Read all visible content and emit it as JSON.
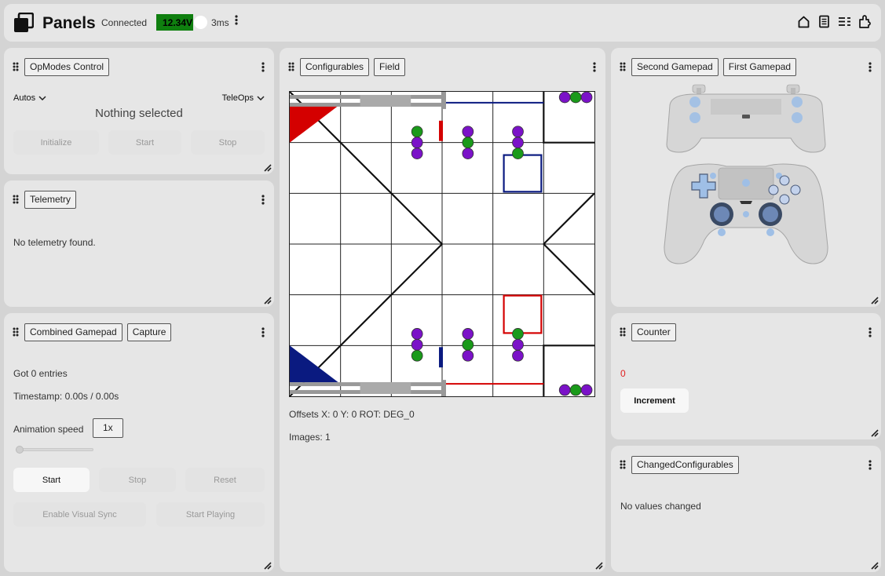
{
  "header": {
    "title": "Panels",
    "connection_status": "Connected",
    "battery_voltage": "12.34V",
    "battery_level": 0.75,
    "battery_color": "#0f7f0f",
    "latency": "3ms",
    "icons": [
      "panels-logo-icon",
      "more-vertical-icon",
      "home-icon",
      "document-icon",
      "list-settings-icon",
      "plugin-icon"
    ]
  },
  "opmodes": {
    "tab": "OpModes Control",
    "autos_label": "Autos",
    "teleops_label": "TeleOps",
    "status": "Nothing selected",
    "buttons": {
      "initialize": "Initialize",
      "start": "Start",
      "stop": "Stop"
    }
  },
  "telemetry": {
    "tab": "Telemetry",
    "message": "No telemetry found."
  },
  "combined": {
    "tabs": [
      "Combined Gamepad",
      "Capture"
    ],
    "entries": "Got 0 entries",
    "timestamp": "Timestamp: 0.00s / 0.00s",
    "speed_label": "Animation speed",
    "speed_value": "1x",
    "slider_value": 0,
    "buttons": {
      "start": "Start",
      "stop": "Stop",
      "reset": "Reset",
      "visual_sync": "Enable Visual Sync",
      "start_playing": "Start Playing"
    }
  },
  "field": {
    "tabs": [
      "Configurables",
      "Field"
    ],
    "offsets": "Offsets X: 0 Y: 0 ROT: DEG_0",
    "images": "Images: 1",
    "colors": {
      "red": "#d40000",
      "blue": "#0a1a80",
      "green": "#1a9a1a",
      "purple": "#7b12c8"
    }
  },
  "gamepads": {
    "tabs": [
      "Second Gamepad",
      "First Gamepad"
    ]
  },
  "counter": {
    "tab": "Counter",
    "value": "0",
    "button": "Increment"
  },
  "changed": {
    "tab": "ChangedConfigurables",
    "message": "No values changed"
  }
}
